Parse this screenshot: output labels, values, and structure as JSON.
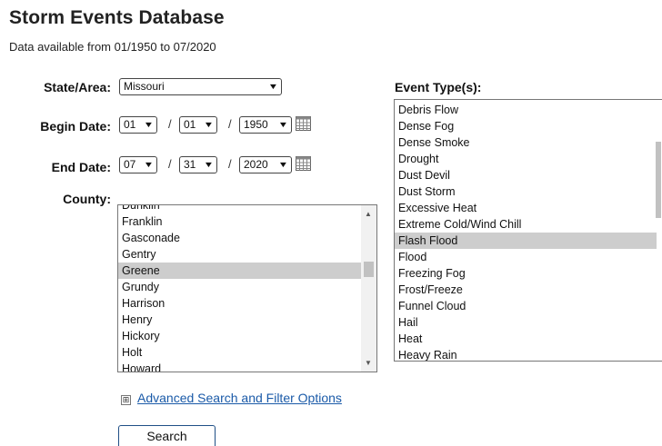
{
  "page": {
    "title": "Storm Events Database",
    "subtitle": "Data available from 01/1950 to 07/2020"
  },
  "form": {
    "state_label": "State/Area:",
    "state_value": "Missouri",
    "begin_label": "Begin Date:",
    "begin_month": "01",
    "begin_day": "01",
    "begin_year": "1950",
    "end_label": "End Date:",
    "end_month": "07",
    "end_day": "31",
    "end_year": "2020",
    "date_separator": "/",
    "county_label": "County:",
    "counties": [
      "Dunklin",
      "Franklin",
      "Gasconade",
      "Gentry",
      "Greene",
      "Grundy",
      "Harrison",
      "Henry",
      "Hickory",
      "Holt",
      "Howard"
    ],
    "county_selected": "Greene",
    "event_label": "Event Type(s):",
    "event_types": [
      "Debris Flow",
      "Dense Fog",
      "Dense Smoke",
      "Drought",
      "Dust Devil",
      "Dust Storm",
      "Excessive Heat",
      "Extreme Cold/Wind Chill",
      "Flash Flood",
      "Flood",
      "Freezing Fog",
      "Frost/Freeze",
      "Funnel Cloud",
      "Hail",
      "Heat",
      "Heavy Rain"
    ],
    "event_selected": "Flash Flood",
    "advanced_toggle": "⊞",
    "advanced_link": "Advanced Search and Filter Options",
    "search_button": "Search"
  },
  "icons": {
    "dropdown": "chevron-down-icon",
    "calendar": "calendar-icon",
    "expand": "plus-box-icon"
  },
  "colors": {
    "link": "#1a5aa8",
    "selected_row": "#cdcdcd",
    "button_border": "#1f4f86"
  }
}
